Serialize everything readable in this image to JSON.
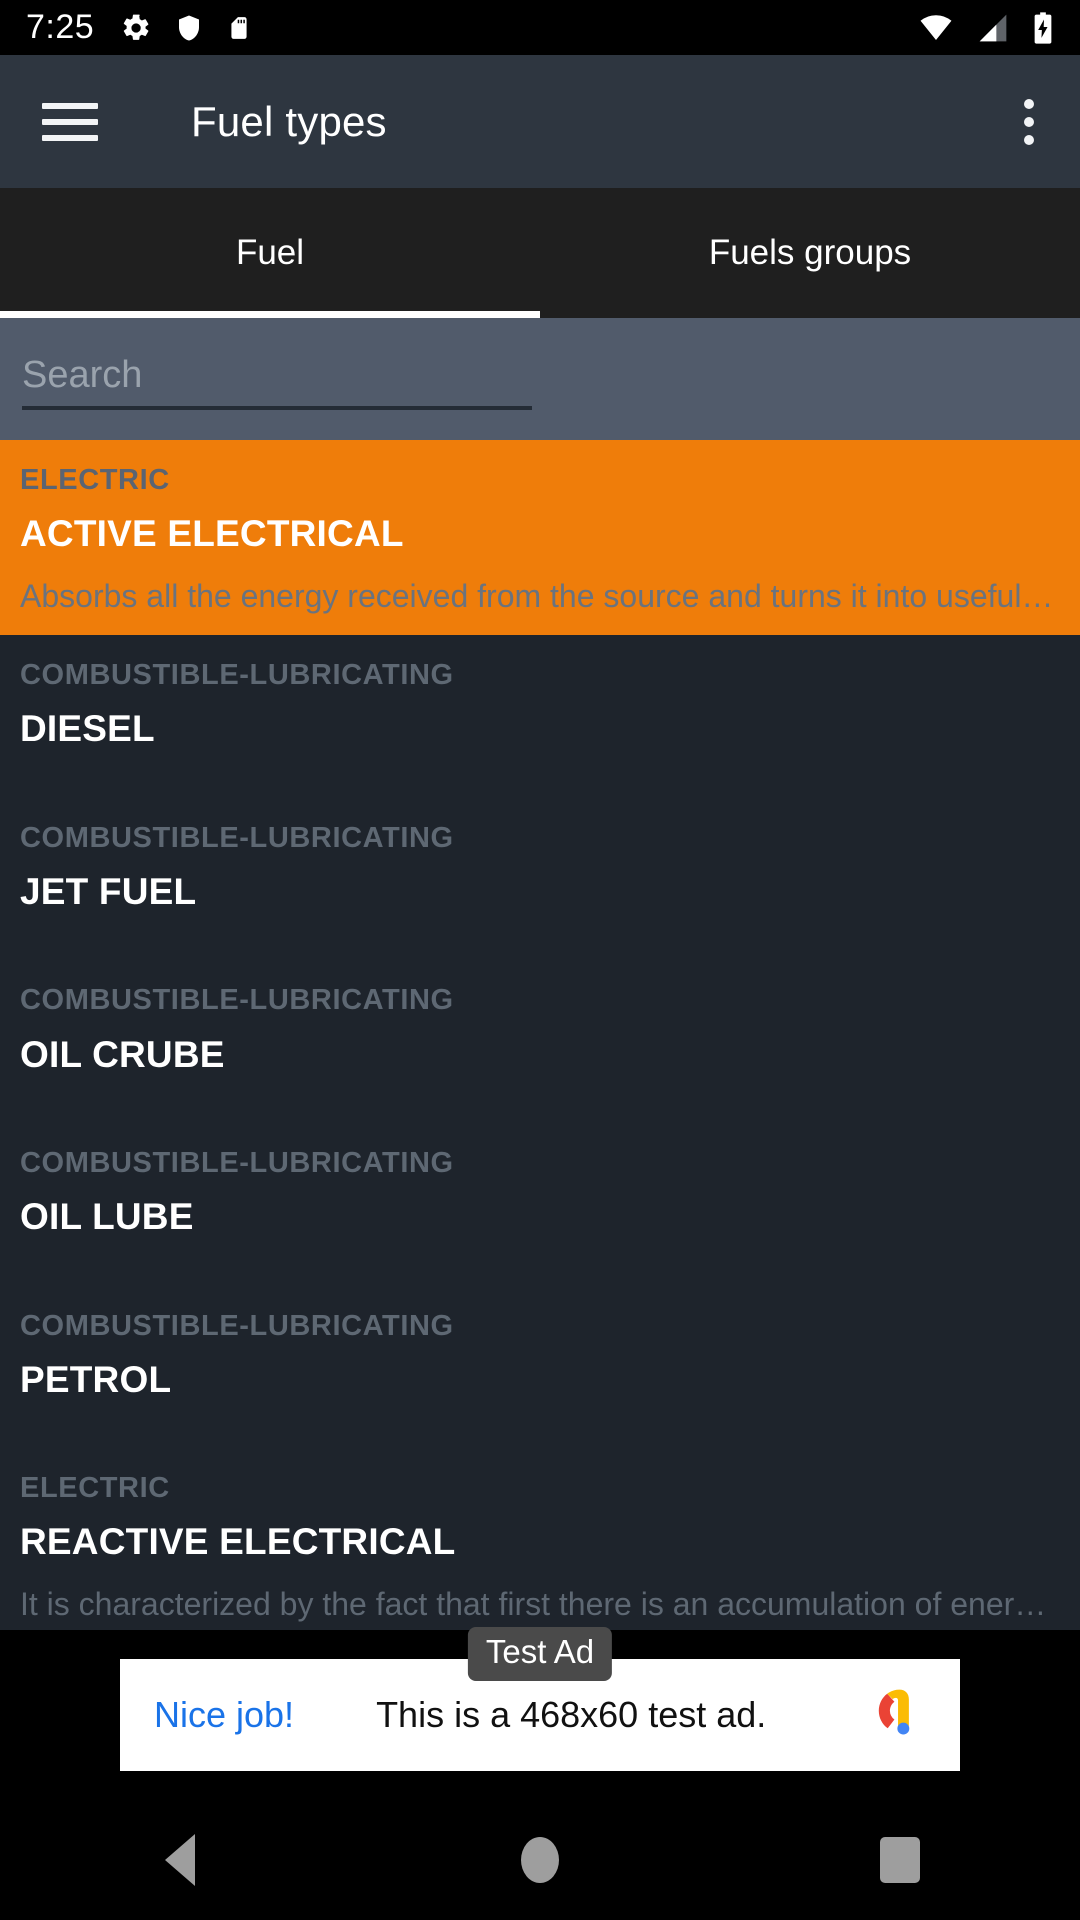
{
  "status_bar": {
    "time": "7:25",
    "left_icons": [
      "gear-icon",
      "shield-icon",
      "sdcard-icon"
    ],
    "right_icons": [
      "wifi-icon",
      "cellular-signal-icon",
      "battery-charging-icon"
    ]
  },
  "app_bar": {
    "menu_icon": "hamburger-menu-icon",
    "title": "Fuel types",
    "overflow_icon": "overflow-menu-icon"
  },
  "tabs": {
    "items": [
      {
        "label": "Fuel",
        "active": true
      },
      {
        "label": "Fuels groups",
        "active": false
      }
    ]
  },
  "search": {
    "placeholder": "Search",
    "value": ""
  },
  "list": {
    "items": [
      {
        "category": "ELECTRIC",
        "title": "ACTIVE ELECTRICAL",
        "description": "Absorbs all the energy received from the source and turns it into useful wo…",
        "selected": true
      },
      {
        "category": "COMBUSTIBLE-LUBRICATING",
        "title": "DIESEL",
        "description": "",
        "selected": false
      },
      {
        "category": "COMBUSTIBLE-LUBRICATING",
        "title": "JET FUEL",
        "description": "",
        "selected": false
      },
      {
        "category": "COMBUSTIBLE-LUBRICATING",
        "title": "OIL CRUBE",
        "description": "",
        "selected": false
      },
      {
        "category": "COMBUSTIBLE-LUBRICATING",
        "title": "OIL LUBE",
        "description": "",
        "selected": false
      },
      {
        "category": "COMBUSTIBLE-LUBRICATING",
        "title": "PETROL",
        "description": "",
        "selected": false
      },
      {
        "category": "ELECTRIC",
        "title": "REACTIVE ELECTRICAL",
        "description": "It is characterized by the fact that first there is an accumulation of energy …",
        "selected": false
      }
    ]
  },
  "ad": {
    "badge": "Test Ad",
    "headline": "Nice job!",
    "body": "This is a 468x60 test ad.",
    "logo_icon": "admob-logo-icon"
  },
  "nav_bar": {
    "back": "back-nav-button",
    "home": "home-nav-button",
    "recents": "recents-nav-button"
  },
  "colors": {
    "accent_orange": "#ef7d0a",
    "app_bar": "#2e3640",
    "tab_bar": "#1f1f1f",
    "search_bar": "#515b6b",
    "list_bg": "#1e242c",
    "ad_link_blue": "#1a73e8"
  }
}
